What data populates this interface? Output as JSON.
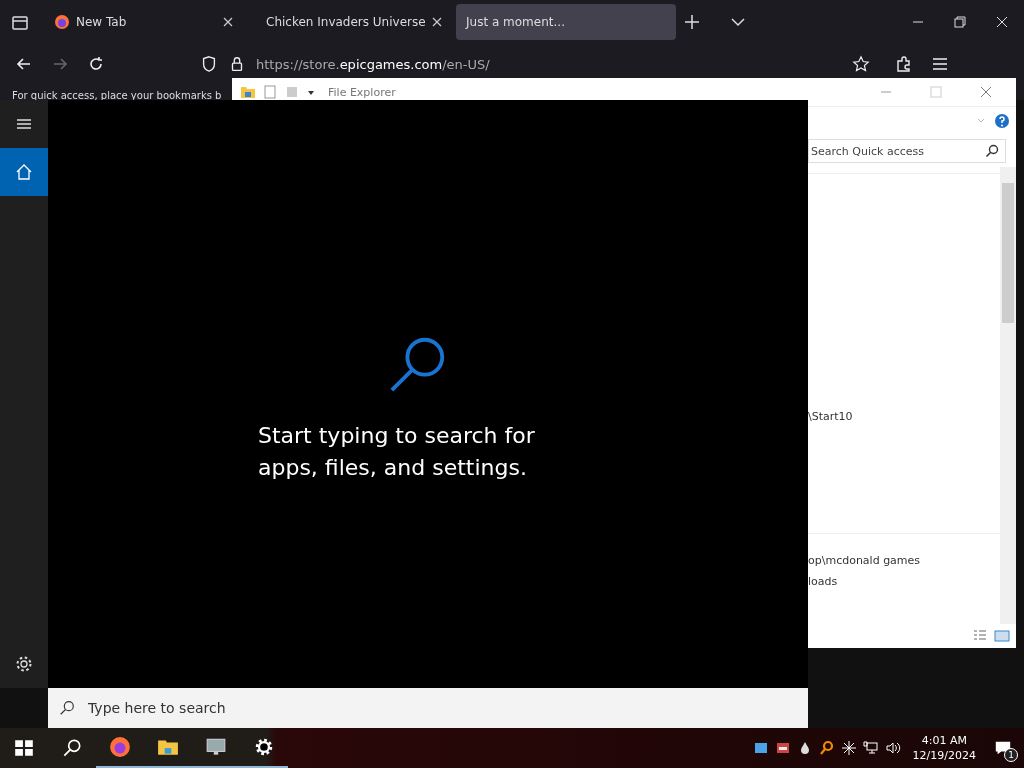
{
  "browser": {
    "tabs": [
      {
        "label": "New Tab",
        "kind": "firefox",
        "selected": false
      },
      {
        "label": "Chicken Invaders Universe",
        "kind": "game",
        "selected": false
      },
      {
        "label": "Just a moment...",
        "kind": "none",
        "selected": true
      }
    ],
    "url": {
      "prefix": "https://store.",
      "domain": "epicgames.com",
      "suffix": "/en-US/"
    },
    "bookmarks_hint": "For quick access, place your bookmarks b"
  },
  "explorer": {
    "title": "File Explorer",
    "search": {
      "placeholder": "Search Quick access"
    },
    "lines": [
      "\\Start10",
      "op\\mcdonald games",
      "loads"
    ]
  },
  "start_search": {
    "rail": [
      {
        "kind": "menu",
        "selected": false
      },
      {
        "kind": "home",
        "selected": true
      },
      {
        "kind": "settings",
        "selected": false
      }
    ],
    "message": "Start typing to search for apps, files, and settings.",
    "search": {
      "placeholder": "Type here to search"
    }
  },
  "taskbar": {
    "apps": [
      {
        "kind": "start",
        "running": false
      },
      {
        "kind": "search",
        "running": false
      },
      {
        "kind": "firefox",
        "running": true
      },
      {
        "kind": "folder",
        "running": true
      },
      {
        "kind": "network",
        "running": true
      },
      {
        "kind": "settings",
        "running": true
      }
    ],
    "time": "4:01 AM",
    "date": "12/19/2024",
    "notifications": "1"
  }
}
